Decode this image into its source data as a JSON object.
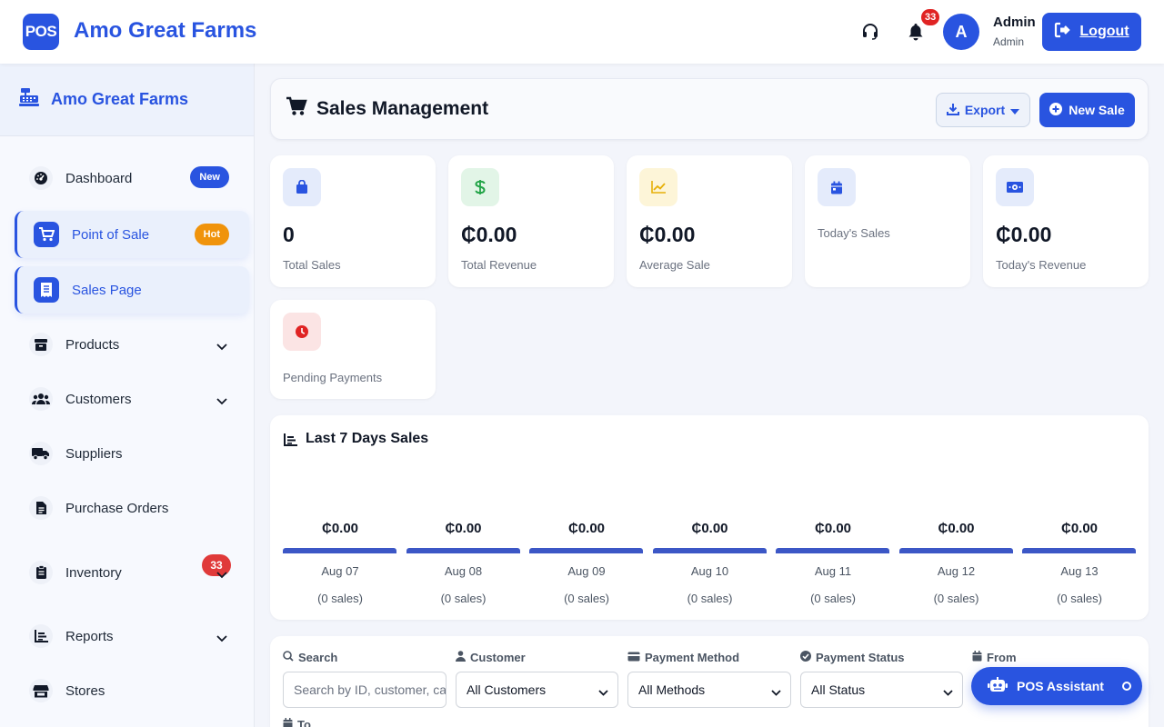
{
  "topbar": {
    "logo_text": "POS",
    "brand": "Amo Great Farms",
    "notification_count": "33",
    "avatar_initial": "A",
    "user_name": "Admin",
    "user_role": "Admin",
    "logout_label": "Logout"
  },
  "sidebar": {
    "title": "Amo Great Farms",
    "items": [
      {
        "label": "Dashboard",
        "icon": "dashboard-icon",
        "badge": "New"
      },
      {
        "label": "Point of Sale",
        "icon": "cart-icon",
        "badge": "Hot"
      },
      {
        "label": "Sales Page",
        "icon": "receipt-icon"
      },
      {
        "label": "Products",
        "icon": "box-icon"
      },
      {
        "label": "Customers",
        "icon": "users-icon"
      },
      {
        "label": "Suppliers",
        "icon": "truck-icon"
      },
      {
        "label": "Purchase Orders",
        "icon": "document-icon"
      },
      {
        "label": "Inventory",
        "icon": "clipboard-icon",
        "badge": "33"
      },
      {
        "label": "Reports",
        "icon": "chart-icon"
      },
      {
        "label": "Stores",
        "icon": "store-icon"
      }
    ]
  },
  "header": {
    "title": "Sales Management",
    "export_label": "Export",
    "new_sale_label": "New Sale"
  },
  "stats": [
    {
      "value": "0",
      "label": "Total Sales",
      "icon": "shopping-bag-icon"
    },
    {
      "value": "₵0.00",
      "label": "Total Revenue",
      "icon": "dollar-icon"
    },
    {
      "value": "₵0.00",
      "label": "Average Sale",
      "icon": "trend-chart-icon"
    },
    {
      "value": "",
      "label": "Today's Sales",
      "icon": "calendar-icon"
    },
    {
      "value": "₵0.00",
      "label": "Today's Revenue",
      "icon": "money-bill-icon"
    },
    {
      "value": "",
      "label": "Pending Payments",
      "icon": "clock-icon"
    }
  ],
  "chart_data": {
    "type": "bar",
    "title": "Last 7 Days Sales",
    "categories": [
      "Aug 07",
      "Aug 08",
      "Aug 09",
      "Aug 10",
      "Aug 11",
      "Aug 12",
      "Aug 13"
    ],
    "values": [
      0,
      0,
      0,
      0,
      0,
      0,
      0
    ],
    "value_labels": [
      "₵0.00",
      "₵0.00",
      "₵0.00",
      "₵0.00",
      "₵0.00",
      "₵0.00",
      "₵0.00"
    ],
    "sales_counts": [
      "(0 sales)",
      "(0 sales)",
      "(0 sales)",
      "(0 sales)",
      "(0 sales)",
      "(0 sales)",
      "(0 sales)"
    ]
  },
  "filters": {
    "search_label": "Search",
    "search_placeholder": "Search by ID, customer, ca",
    "customer_label": "Customer",
    "customer_value": "All Customers",
    "payment_method_label": "Payment Method",
    "payment_method_value": "All Methods",
    "payment_status_label": "Payment Status",
    "payment_status_value": "All Status",
    "from_label": "From",
    "to_label": "To"
  },
  "assistant": {
    "label": "POS Assistant"
  },
  "colors": {
    "accent": "#2954e0",
    "hot": "#f0930b",
    "badge_red": "#e02424"
  }
}
